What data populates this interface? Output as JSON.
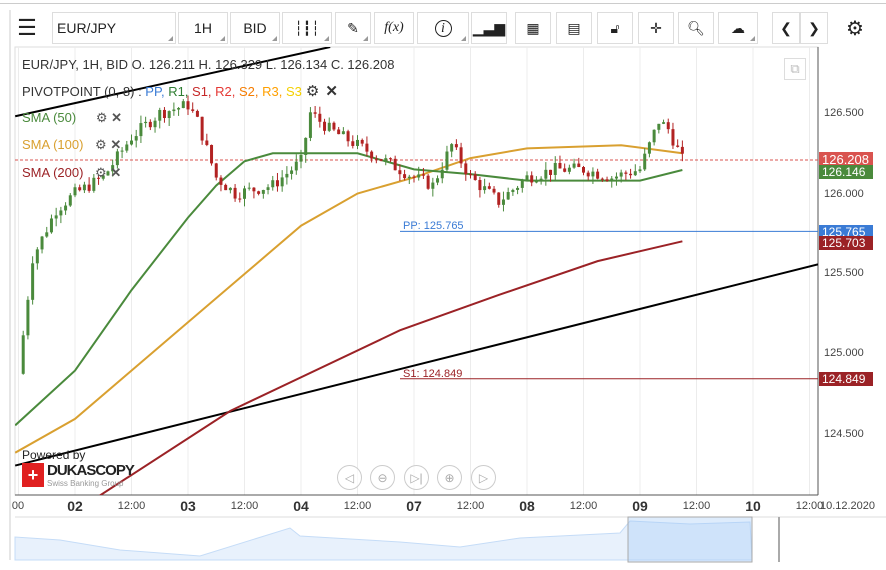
{
  "toolbar": {
    "instrument": "EUR/JPY",
    "period": "1H",
    "side": "BID",
    "icons": [
      "menu-icon",
      "candle-type-icon",
      "draw-icon",
      "indicators-icon",
      "info-icon",
      "volume-icon",
      "calendar-icon",
      "report-icon",
      "lock-icon",
      "crosshair-icon",
      "zoom-icon",
      "upload-icon",
      "prev-icon",
      "next-icon",
      "settings-icon"
    ],
    "fx_label": "f(x)",
    "info_label": "i"
  },
  "legend": {
    "ohlc": "EUR/JPY, 1H, BID   O. 126.211 H. 126.329 L. 126.134 C. 126.208",
    "pivot_name": "PIVOTPOINT (0, 8)",
    "pivot_sep": " : ",
    "pivot_items": [
      {
        "t": "PP",
        "c": "#3a7bd5"
      },
      {
        "t": "R1",
        "c": "#2e7d32"
      },
      {
        "t": "S1",
        "c": "#c62828"
      },
      {
        "t": "R2",
        "c": "#e53935"
      },
      {
        "t": "S2",
        "c": "#f57c00"
      },
      {
        "t": "R3",
        "c": "#ffa000"
      },
      {
        "t": "S3",
        "c": "#f4d000"
      }
    ],
    "sma50": "SMA (50)",
    "sma100": "SMA (100)",
    "sma200": "SMA (200)"
  },
  "colors": {
    "sma50": "#4a8a3c",
    "sma100": "#d9a030",
    "sma200": "#9b2226",
    "pp": "#3a7bd5",
    "s1": "#9b2226",
    "up": "#4a8a3c",
    "down": "#b22222",
    "last": "#d9534f"
  },
  "price_axis": [
    "126.500",
    "126.000",
    "125.500",
    "125.000",
    "124.500"
  ],
  "price_labels": {
    "last": "126.208",
    "sma50": "126.146",
    "pp": "125.765",
    "sma200": "125.703",
    "s1": "124.849"
  },
  "pivot_labels": {
    "pp": "PP: 125.765",
    "s1": "S1: 124.849"
  },
  "time_axis": [
    {
      "t": "00",
      "h": 0,
      "big": false
    },
    {
      "t": "02",
      "h": 24,
      "big": true
    },
    {
      "t": "12:00",
      "h": 36,
      "big": false
    },
    {
      "t": "03",
      "h": 48,
      "big": true
    },
    {
      "t": "12:00",
      "h": 60,
      "big": false
    },
    {
      "t": "04",
      "h": 72,
      "big": true
    },
    {
      "t": "12:00",
      "h": 84,
      "big": false
    },
    {
      "t": "07",
      "h": 96,
      "big": true
    },
    {
      "t": "12:00",
      "h": 108,
      "big": false
    },
    {
      "t": "08",
      "h": 120,
      "big": true
    },
    {
      "t": "12:00",
      "h": 132,
      "big": false
    },
    {
      "t": "09",
      "h": 144,
      "big": true
    },
    {
      "t": "12:00",
      "h": 156,
      "big": false
    },
    {
      "t": "10",
      "h": 168,
      "big": true
    },
    {
      "t": "12:00",
      "h": 180,
      "big": false
    },
    {
      "t": "10.12.2020",
      "h": 185,
      "big": false
    }
  ],
  "brand": {
    "powered": "Powered by",
    "name": "DUKASCOPY",
    "sub": "Swiss Banking Group"
  },
  "chart_data": {
    "type": "line",
    "closes": [
      [
        12,
        124.88
      ],
      [
        15,
        125.6
      ],
      [
        20,
        125.9
      ],
      [
        24,
        126.0
      ],
      [
        30,
        126.1
      ],
      [
        36,
        126.35
      ],
      [
        42,
        126.5
      ],
      [
        48,
        126.55
      ],
      [
        50,
        126.45
      ],
      [
        54,
        126.1
      ],
      [
        58,
        126.0
      ],
      [
        66,
        126.05
      ],
      [
        72,
        126.2
      ],
      [
        74,
        126.5
      ],
      [
        78,
        126.4
      ],
      [
        84,
        126.3
      ],
      [
        90,
        126.2
      ],
      [
        96,
        126.1
      ],
      [
        100,
        126.05
      ],
      [
        104,
        126.3
      ],
      [
        108,
        126.1
      ],
      [
        114,
        125.95
      ],
      [
        120,
        126.1
      ],
      [
        126,
        126.15
      ],
      [
        132,
        126.15
      ],
      [
        138,
        126.1
      ],
      [
        144,
        126.15
      ],
      [
        148,
        126.45
      ],
      [
        150,
        126.4
      ],
      [
        153,
        126.21
      ]
    ],
    "sma50": [
      [
        11.3,
        124.56
      ],
      [
        24,
        124.9
      ],
      [
        36,
        125.4
      ],
      [
        48,
        125.85
      ],
      [
        54,
        126.05
      ],
      [
        60,
        126.2
      ],
      [
        66,
        126.25
      ],
      [
        84,
        126.25
      ],
      [
        96,
        126.15
      ],
      [
        108,
        126.12
      ],
      [
        120,
        126.08
      ],
      [
        144,
        126.08
      ],
      [
        153,
        126.146
      ]
    ],
    "sma100": [
      [
        11.3,
        124.39
      ],
      [
        24,
        124.6
      ],
      [
        48,
        125.2
      ],
      [
        60,
        125.5
      ],
      [
        72,
        125.8
      ],
      [
        84,
        126.0
      ],
      [
        96,
        126.1
      ],
      [
        108,
        126.22
      ],
      [
        120,
        126.28
      ],
      [
        140,
        126.3
      ],
      [
        153,
        126.25
      ]
    ],
    "sma200": [
      [
        28,
        124.1
      ],
      [
        57,
        124.65
      ],
      [
        93,
        125.15
      ],
      [
        114,
        125.37
      ],
      [
        135,
        125.58
      ],
      [
        153,
        125.703
      ]
    ],
    "trendlines": [
      [
        [
          11.3,
          124.31
        ],
        [
          181.8,
          125.56
        ]
      ],
      [
        [
          11.3,
          126.48
        ],
        [
          78.2,
          126.91
        ]
      ]
    ],
    "pivots": {
      "pp": 125.765,
      "s1": 124.849
    },
    "last": 126.208,
    "ylim": [
      124.1,
      126.91
    ]
  }
}
